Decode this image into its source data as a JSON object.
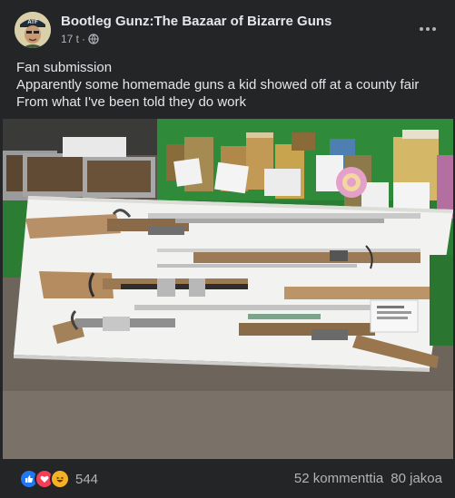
{
  "post": {
    "page_name": "Bootleg Gunz:The Bazaar of Bizarre Guns",
    "time": "17 t",
    "separator": "·",
    "privacy_icon": "globe-icon",
    "more_icon": "more-horizontal-icon",
    "text_lines": [
      "Fan submission",
      "Apparently some homemade guns a kid showed off at a county fair",
      "From what I've been told they do work"
    ],
    "avatar_label": "ATF"
  },
  "footer": {
    "reaction_icons": [
      "like-icon",
      "love-icon",
      "haha-icon"
    ],
    "reaction_count": "544",
    "comments": "52 kommenttia",
    "shares": "80 jakoa"
  },
  "colors": {
    "background": "#242526",
    "text_primary": "#e4e6eb",
    "text_secondary": "#b0b3b8",
    "like_blue": "#2078f4",
    "love_red": "#f33e58",
    "haha_yellow": "#f7b125"
  }
}
